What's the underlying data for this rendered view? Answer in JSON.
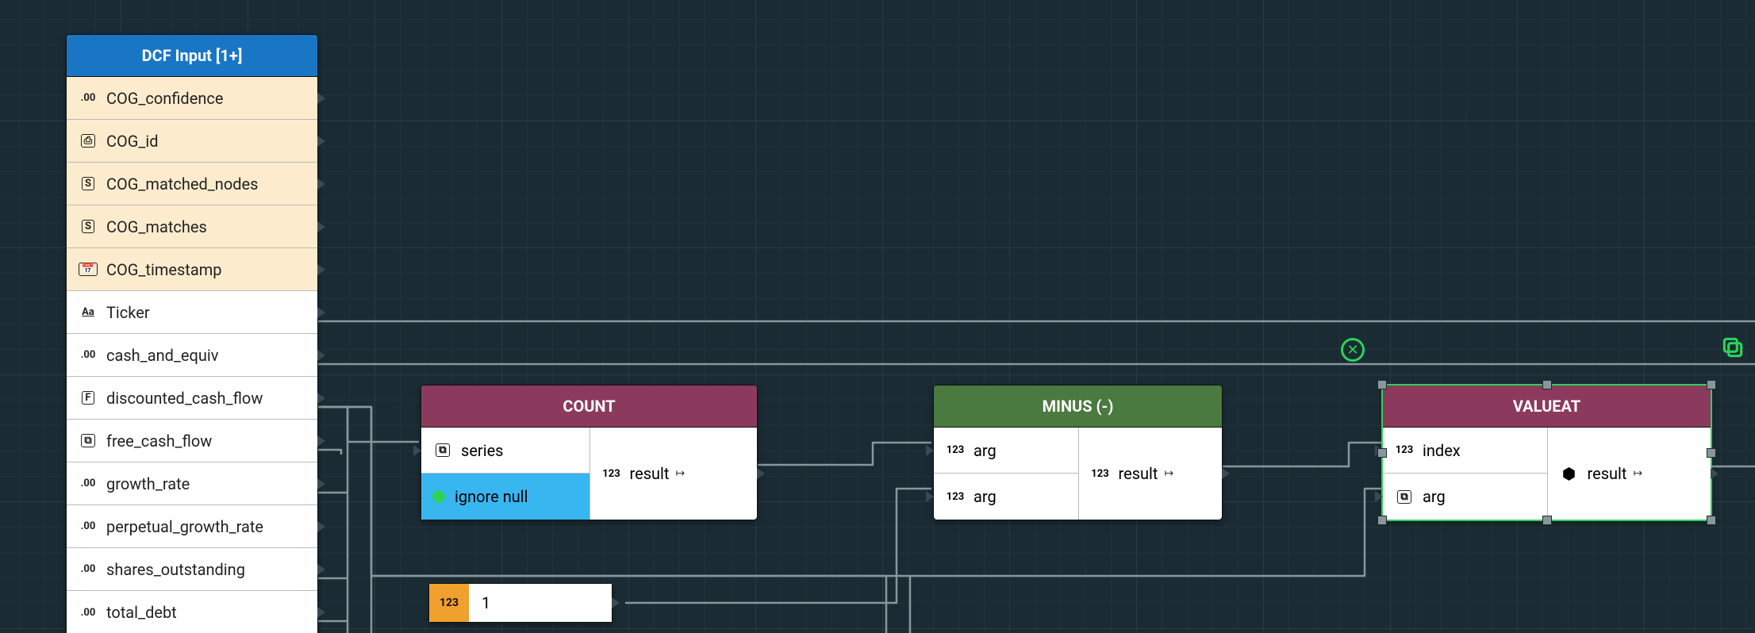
{
  "input_node": {
    "title": "DCF Input [1+]",
    "fields": [
      {
        "name": "COG_confidence",
        "type": "float",
        "cog": true
      },
      {
        "name": "COG_id",
        "type": "id",
        "cog": true
      },
      {
        "name": "COG_matched_nodes",
        "type": "slist",
        "cog": true
      },
      {
        "name": "COG_matches",
        "type": "slist",
        "cog": true
      },
      {
        "name": "COG_timestamp",
        "type": "date",
        "cog": true
      },
      {
        "name": "Ticker",
        "type": "text",
        "cog": false
      },
      {
        "name": "cash_and_equiv",
        "type": "float",
        "cog": false
      },
      {
        "name": "discounted_cash_flow",
        "type": "flist",
        "cog": false
      },
      {
        "name": "free_cash_flow",
        "type": "list",
        "cog": false
      },
      {
        "name": "growth_rate",
        "type": "float",
        "cog": false
      },
      {
        "name": "perpetual_growth_rate",
        "type": "float",
        "cog": false
      },
      {
        "name": "shares_outstanding",
        "type": "float",
        "cog": false
      },
      {
        "name": "total_debt",
        "type": "float",
        "cog": false
      }
    ]
  },
  "count_node": {
    "title": "COUNT",
    "input_series": "series",
    "input_ignore_null": "ignore null",
    "output": "result",
    "output_type": "123"
  },
  "minus_node": {
    "title": "MINUS (-)",
    "arg1": "arg",
    "arg2": "arg",
    "arg_type": "123",
    "output": "result",
    "output_type": "123"
  },
  "valueat_node": {
    "title": "VALUEAT",
    "index": "index",
    "index_type": "123",
    "arg": "arg",
    "output": "result"
  },
  "const_node": {
    "tag": "123",
    "value": "1"
  }
}
